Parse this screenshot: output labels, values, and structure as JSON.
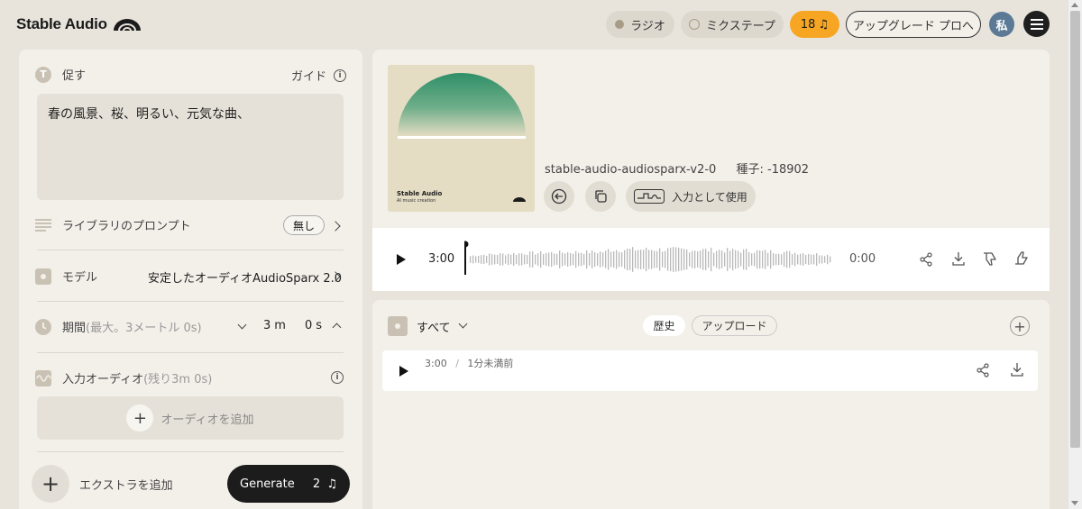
{
  "header": {
    "logo_text": "Stable Audio",
    "radio_label": "ラジオ",
    "mixtape_label": "ミクステープ",
    "credits": "18",
    "upgrade_label": "アップグレード プロへ",
    "avatar_text": "私"
  },
  "prompt": {
    "title": "促す",
    "guide_label": "ガイド",
    "text": "春の風景、桜、明るい、元気な曲、"
  },
  "library": {
    "label": "ライブラリのプロンプト",
    "value": "無し"
  },
  "model": {
    "label": "モデル",
    "value": "安定したオーディオAudioSparx 2.0"
  },
  "duration": {
    "label": "期間",
    "hint": "(最大。3メートル 0s)",
    "minutes": "3",
    "minutes_unit": "m",
    "seconds": "0",
    "seconds_unit": "s"
  },
  "input_audio": {
    "label": "入力オーディオ",
    "hint": "(残り3m 0s)",
    "add_label": "オーディオを追加"
  },
  "footer": {
    "extras_label": "エクストラを追加",
    "generate_label": "Generate",
    "generate_cost": "2"
  },
  "result": {
    "album_title": "Stable Audio",
    "album_subtitle": "AI music creation",
    "model_id": "stable-audio-audiosparx-v2-0",
    "seed_label": "種子:",
    "seed_value": "-18902",
    "use_as_input_label": "入力として使用"
  },
  "player": {
    "duration": "3:00",
    "position": "0:00"
  },
  "history": {
    "filter_label": "すべて",
    "tab_history": "歴史",
    "tab_upload": "アップロード",
    "items": [
      {
        "duration": "3:00",
        "separator": "/",
        "time_ago": "1分未満前"
      }
    ]
  },
  "colors": {
    "accent_orange": "#f6a623",
    "album_green": "#2f8f68",
    "panel_bg": "#f3f0ea",
    "page_bg": "#e8e4dc"
  }
}
